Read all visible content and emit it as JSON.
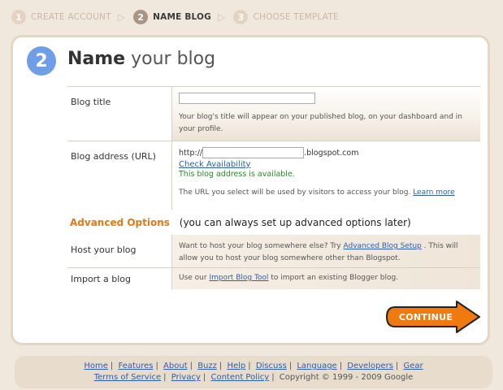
{
  "steps": [
    {
      "num": "1",
      "label": "CREATE ACCOUNT",
      "active": false
    },
    {
      "num": "2",
      "label": "NAME BLOG",
      "active": true
    },
    {
      "num": "3",
      "label": "CHOOSE TEMPLATE",
      "active": false
    }
  ],
  "header": {
    "step_num": "2",
    "title_bold": "Name",
    "title_rest": "your blog"
  },
  "blog_title": {
    "label": "Blog title",
    "value": "",
    "help": "Your blog's title will appear on your published blog, on your dashboard and in your profile."
  },
  "blog_address": {
    "label": "Blog address (URL)",
    "prefix": "http://",
    "value": "",
    "suffix": ".blogspot.com",
    "check_link": "Check Availability",
    "status": "This blog address is available.",
    "help": "The URL you select will be used by visitors to access your blog.",
    "learn_more": "Learn more"
  },
  "advanced": {
    "title": "Advanced Options",
    "note": "(you can always set up advanced options later)"
  },
  "host": {
    "label": "Host your blog",
    "text_before": "Want to host your blog somewhere else? Try",
    "link": "Advanced Blog Setup",
    "text_after": ". This will allow you to host your blog somewhere other than Blogspot."
  },
  "import": {
    "label": "Import a blog",
    "text_before": "Use our",
    "link": "Import Blog Tool",
    "text_after": "to import an existing Blogger blog."
  },
  "continue_label": "CONTINUE",
  "colors": {
    "accent_orange": "#f07a10",
    "step_blue": "#6f9ee8",
    "link_blue": "#2d5ea8",
    "ok_green": "#2a8a2a"
  },
  "footer": {
    "links1": [
      "Home",
      "Features",
      "About",
      "Buzz",
      "Help",
      "Discuss",
      "Language",
      "Developers",
      "Gear"
    ],
    "links2": [
      "Terms of Service",
      "Privacy",
      "Content Policy"
    ],
    "copyright": "Copyright © 1999 - 2009 Google"
  }
}
